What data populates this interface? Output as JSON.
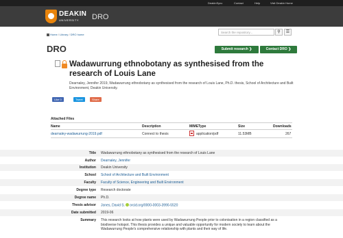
{
  "topbar": {
    "links": [
      "DeakinSync",
      "Contact",
      "Help",
      "Visit Deakin Home"
    ]
  },
  "header": {
    "brand": "DEAKIN",
    "brand_sub": "UNIVERSITY",
    "app_name": "DRO"
  },
  "breadcrumb": {
    "home": "Home",
    "library": "Library",
    "dro_home": "DRO home"
  },
  "search": {
    "placeholder": "Search the repository..."
  },
  "page_heading": "DRO",
  "buttons": {
    "submit": "Submit research ❯",
    "contact": "Contact DRO ❯"
  },
  "record": {
    "title": "Wadawurrung ethnobotany as synthesised from the research of Louis Lane",
    "citation": "Dearnaley, Jennifer 2019, Wadawurrung ethnobotany as synthesised from the research of Louis Lane, Ph.D. thesis, School of Architecture and Built Environment, Deakin University."
  },
  "share": {
    "like": "Like 0",
    "tweet": "Tweet",
    "share": "Share"
  },
  "files": {
    "heading": "Attached Files",
    "columns": [
      "Name",
      "Description",
      "MIMEType",
      "Size",
      "Downloads"
    ],
    "rows": [
      {
        "name": "dearnaley-wadawurrung-2019.pdf",
        "description": "Connect to thesis",
        "mimetype": "application/pdf",
        "size": "11.53MB",
        "downloads": "267"
      }
    ]
  },
  "metadata": {
    "title": {
      "label": "Title",
      "value": "Wadawurrung ethnobotany as synthesised from the research of Louis Lane"
    },
    "author": {
      "label": "Author",
      "value": "Dearnaley, Jennifer"
    },
    "institution": {
      "label": "Institution",
      "value": "Deakin University"
    },
    "school": {
      "label": "School",
      "value": "School of Architecture and Built Environment"
    },
    "faculty": {
      "label": "Faculty",
      "value": "Faculty of Science, Engineering and Built Environment"
    },
    "degree_type": {
      "label": "Degree type",
      "value": "Research doctorate"
    },
    "degree_name": {
      "label": "Degree name",
      "value": "Ph.D."
    },
    "advisor": {
      "label": "Thesis advisor",
      "value": "Jones, David S.",
      "orcid": "orcid.org/0000-0003-3990-5520"
    },
    "date": {
      "label": "Date submitted",
      "value": "2019-06"
    },
    "summary": {
      "label": "Summary",
      "value": "This research looks at how plants were used by Wadawurrung People prior to colonisation in a region classified as a biodiverse hotspot. This thesis provides a unique and valuable opportunity for modern society to learn about the Wadawurrung People's comprehensive relationship with plants and their way of life."
    }
  }
}
